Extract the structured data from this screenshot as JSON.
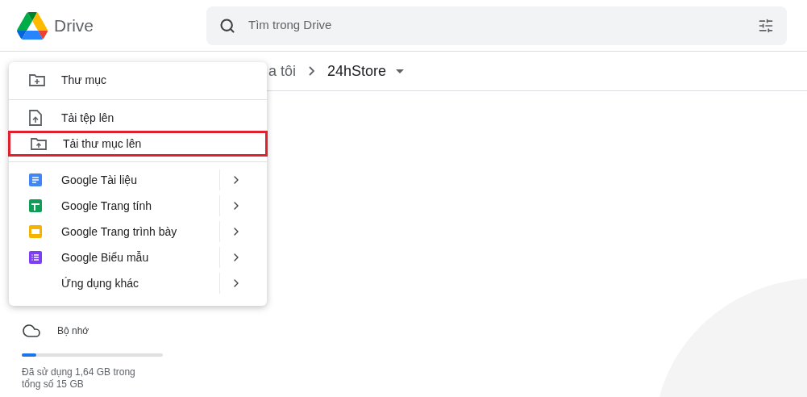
{
  "header": {
    "app_name": "Drive",
    "search": {
      "placeholder": "Tìm trong Drive"
    }
  },
  "breadcrumb": {
    "items": [
      {
        "label": "a tôi"
      },
      {
        "label": "24hStore"
      }
    ]
  },
  "menu": {
    "sections": [
      [
        {
          "label": "Thư mục",
          "kind": "new-folder",
          "has_submenu": false,
          "highlighted": false
        }
      ],
      [
        {
          "label": "Tải tệp lên",
          "kind": "upload-file",
          "has_submenu": false,
          "highlighted": false
        },
        {
          "label": "Tải thư mục lên",
          "kind": "upload-folder",
          "has_submenu": false,
          "highlighted": true
        }
      ],
      [
        {
          "label": "Google Tài liệu",
          "kind": "docs",
          "has_submenu": true,
          "highlighted": false
        },
        {
          "label": "Google Trang tính",
          "kind": "sheets",
          "has_submenu": true,
          "highlighted": false
        },
        {
          "label": "Google Trang trình bày",
          "kind": "slides",
          "has_submenu": true,
          "highlighted": false
        },
        {
          "label": "Google Biểu mẫu",
          "kind": "forms",
          "has_submenu": true,
          "highlighted": false
        },
        {
          "label": "Ứng dụng khác",
          "kind": "plain",
          "has_submenu": true,
          "highlighted": false
        }
      ]
    ]
  },
  "storage": {
    "label": "Bộ nhớ",
    "level": 0.1,
    "usage": "Đã sử dụng 1,64 GB trong tổng số 15 GB"
  }
}
